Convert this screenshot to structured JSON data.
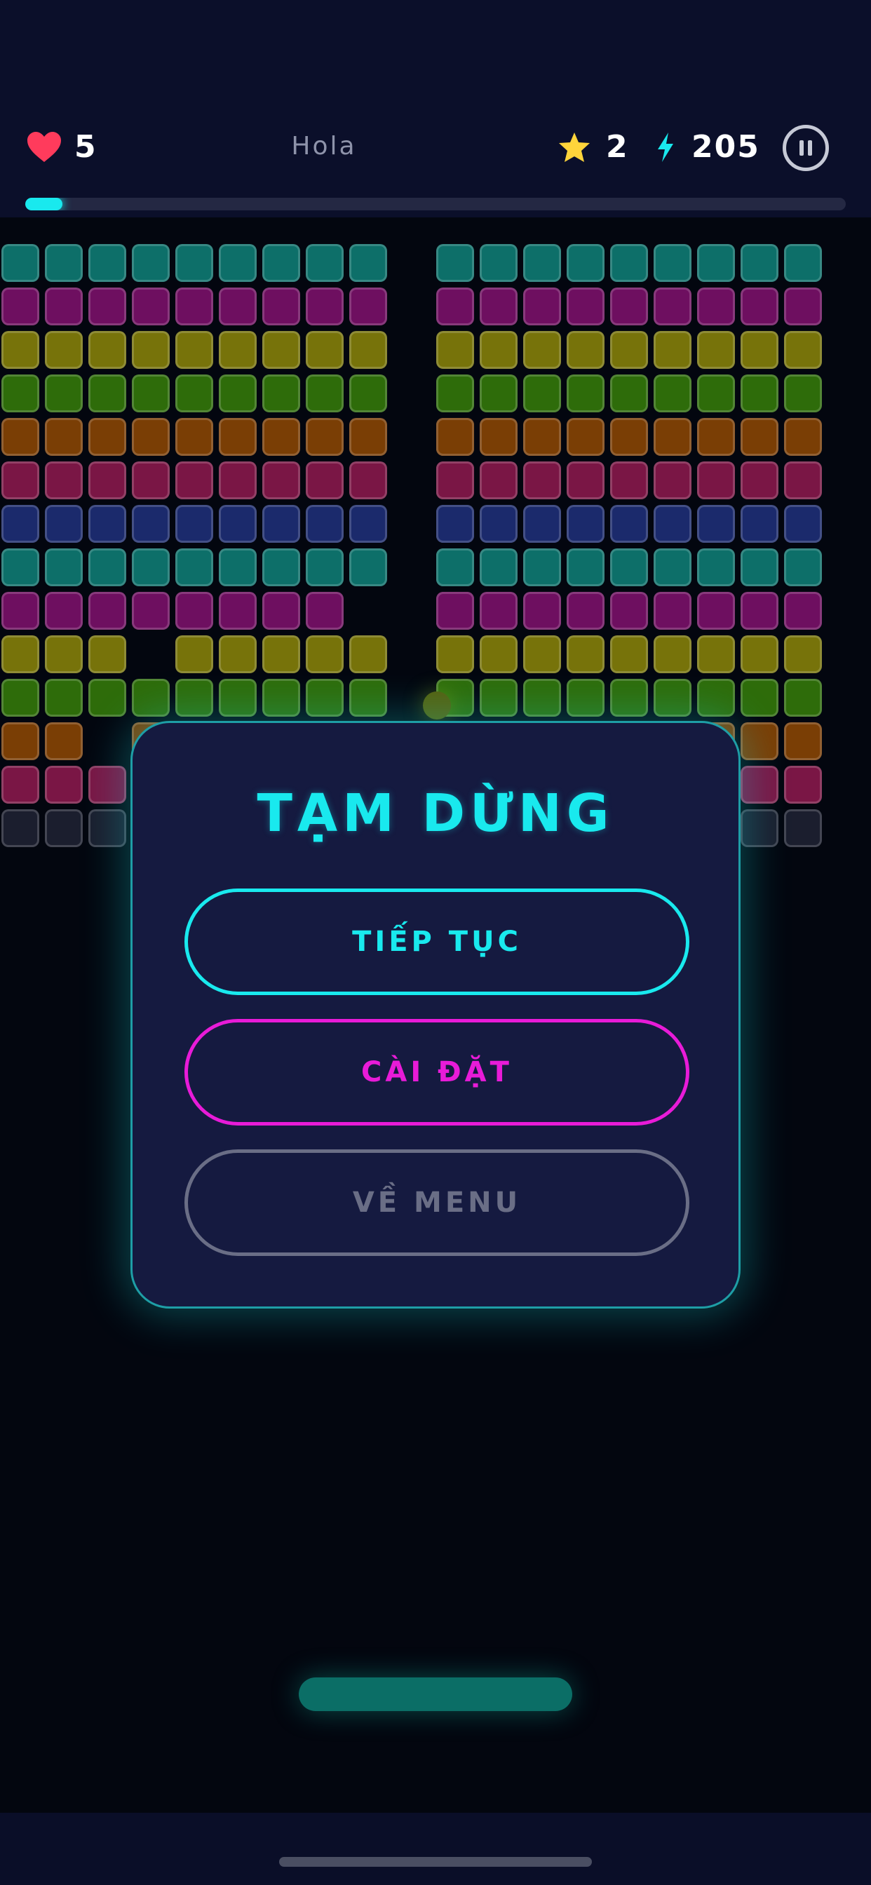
{
  "hud": {
    "lives": "5",
    "level_name": "Hola",
    "stars": "2",
    "energy": "205",
    "progress": 0.045
  },
  "pause_menu": {
    "title": "TẠM DỪNG",
    "resume_label": "TIẾP TỤC",
    "settings_label": "CÀI ĐẶT",
    "menu_label": "VỀ MENU"
  },
  "colors": {
    "accent_cyan": "#19e9ee",
    "accent_magenta": "#e81bd8",
    "muted_gray": "#6a6e86",
    "heart_red": "#ff3b5c",
    "star_yellow": "#ffd43b",
    "row_colors": [
      "#0d6f69",
      "#6e0f60",
      "#77730a",
      "#2e6c0a",
      "#7a3e05",
      "#7a1645",
      "#1b2a6c",
      "#0d6f69",
      "#6e0f60",
      "#77730a",
      "#2e6c0a",
      "#7a3e05",
      "#7a1645",
      "#1b1e2e"
    ]
  },
  "icons": {
    "lives": "heart-icon",
    "stars": "star-icon",
    "energy": "bolt-icon",
    "pause": "pause-icon"
  },
  "bricks": {
    "rows": [
      "111111111__111111111",
      "111111111__111111111",
      "111111111__111111111",
      "111111111__111111111",
      "111111111_1111111111",
      "111111111_1111111111",
      "111111111_1111111111",
      "111111111_1111111111",
      "11111111__1111111111",
      "111_11111_1111111111",
      "111111111__111111111",
      "11_1111111111111111",
      "1111111111111111111",
      "1111111111111111111"
    ]
  }
}
